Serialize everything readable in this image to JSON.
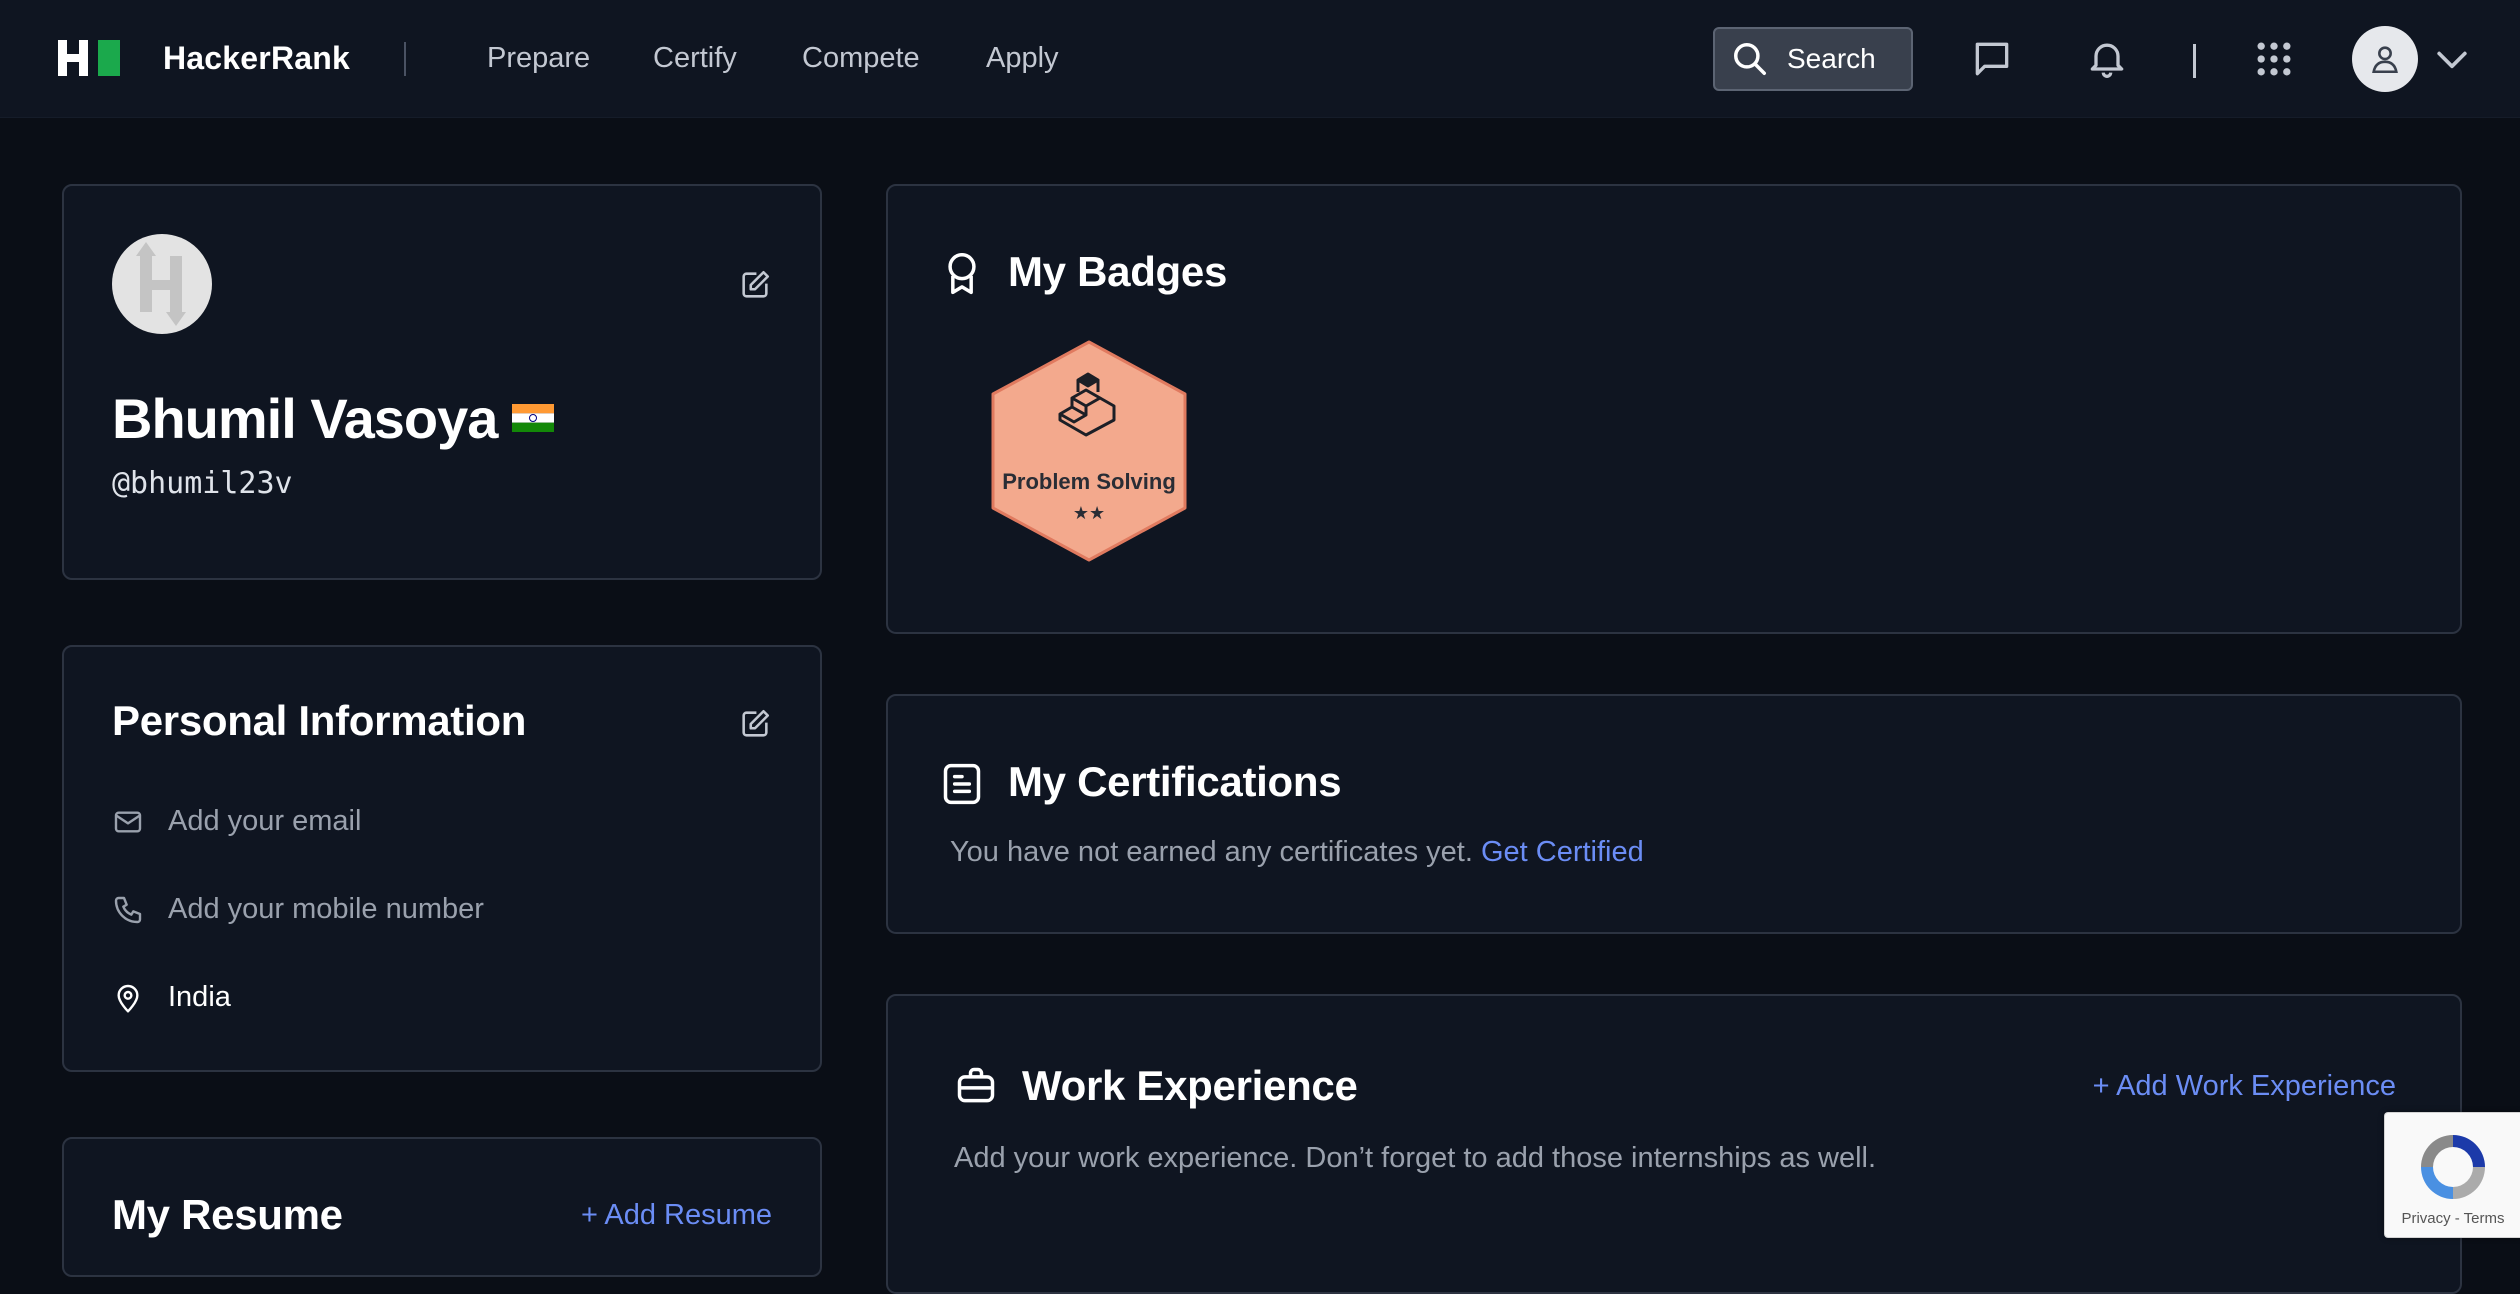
{
  "header": {
    "brand": "HackerRank",
    "nav": [
      "Prepare",
      "Certify",
      "Compete",
      "Apply"
    ],
    "search_label": "Search",
    "logo_color": "#1ba94c"
  },
  "profile": {
    "name": "Bhumil Vasoya",
    "handle": "@bhumil23v",
    "country_flag": "India"
  },
  "personal_info": {
    "title": "Personal Information",
    "email_placeholder": "Add your email",
    "mobile_placeholder": "Add your mobile number",
    "location": "India"
  },
  "resume": {
    "title": "My Resume",
    "add_label": "+ Add Resume"
  },
  "badges": {
    "title": "My Badges",
    "items": [
      {
        "name": "Problem Solving",
        "stars": 2,
        "color": "#f3a98d"
      }
    ]
  },
  "certifications": {
    "title": "My Certifications",
    "empty_text": "You have not earned any certificates yet.",
    "cta": "Get Certified"
  },
  "work_experience": {
    "title": "Work Experience",
    "add_label": "+ Add Work Experience",
    "empty_text": "Add your work experience. Don’t forget to add those internships as well."
  },
  "recaptcha": {
    "terms": "Privacy - Terms"
  },
  "colors": {
    "background": "#0a0e16",
    "card": "#0f1521",
    "border": "#2c3341",
    "link": "#6b8df5"
  }
}
